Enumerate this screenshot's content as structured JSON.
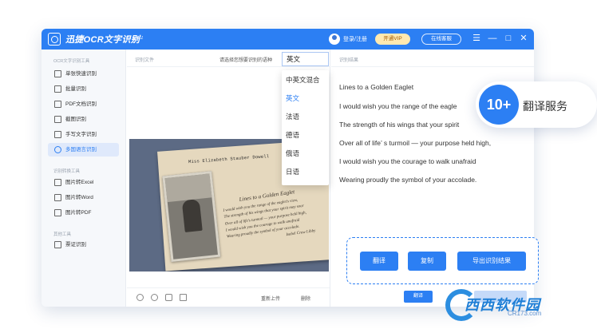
{
  "titlebar": {
    "app_title": "迅捷OCR文字识别",
    "version": "v8.6.4.2",
    "login": "登录/注册",
    "vip": "开通VIP",
    "service": "在线客服",
    "menu_icon": "☰",
    "minimize_icon": "—",
    "maximize_icon": "□",
    "close_icon": "✕"
  },
  "sidebar": {
    "group1": "OCR文字识别工具",
    "items1": [
      {
        "label": "单张快速识别",
        "icon": "document-scan-icon"
      },
      {
        "label": "批量识别",
        "icon": "batch-icon"
      },
      {
        "label": "PDF文档识别",
        "icon": "pdf-icon"
      },
      {
        "label": "截图识别",
        "icon": "screenshot-icon"
      },
      {
        "label": "手写文字识别",
        "icon": "pen-icon"
      },
      {
        "label": "多国语言识别",
        "icon": "globe-icon"
      }
    ],
    "group2": "识别转换工具",
    "items2": [
      {
        "label": "图片转Excel",
        "icon": "excel-icon"
      },
      {
        "label": "图片转Word",
        "icon": "word-icon"
      },
      {
        "label": "图片转PDF",
        "icon": "pdf-convert-icon"
      }
    ],
    "group3": "其他工具",
    "items3": [
      {
        "label": "票证识别",
        "icon": "ticket-icon"
      }
    ]
  },
  "middle": {
    "header_label": "识别文件",
    "lang_prompt": "请选择您想要识别的语种",
    "lang_selected": "英文",
    "photo_name_line": "Miss Elizabeth Stauber Dowell",
    "photo_poem_title": "Lines to a Golden Eaglet",
    "photo_poem_lines": [
      "I would wish you the range of the eaglet's view,",
      "The strength of his wings that your spirit may soar",
      "Over all of life's turmoil — your purpose held high,",
      "I would wish you the courage to walk unafraid",
      "Wearing proudly the symbol of your accolade."
    ],
    "photo_signature": "Isabel Craw Libby",
    "reupload": "重新上传",
    "delete": "删除"
  },
  "dropdown": {
    "options": [
      "中英文混合",
      "英文",
      "法语",
      "德语",
      "俄语",
      "日语"
    ],
    "selected_index": 1
  },
  "right": {
    "header_label": "识别结果",
    "lines": [
      "Lines to a Golden Eaglet",
      "I would wish you the range of the eagle",
      "The strength of his wings that your spirit",
      "Over all of life’ s turmoil — your purpose held high,",
      "I would wish you the courage to walk unafraid",
      "Wearing proudly the symbol of your accolade."
    ]
  },
  "bubble": {
    "count": "10+",
    "text": "翻译服务"
  },
  "actions": {
    "translate": "翻译",
    "copy": "复制",
    "export": "导出识别结果",
    "small_translate": "翻译"
  },
  "watermark": {
    "text": "西西软件园",
    "sub": "CR173.com"
  },
  "colors": {
    "brand": "#2c7ff3",
    "sidebar_bg": "#f6f8fb",
    "active_bg": "#dfe9fb"
  }
}
